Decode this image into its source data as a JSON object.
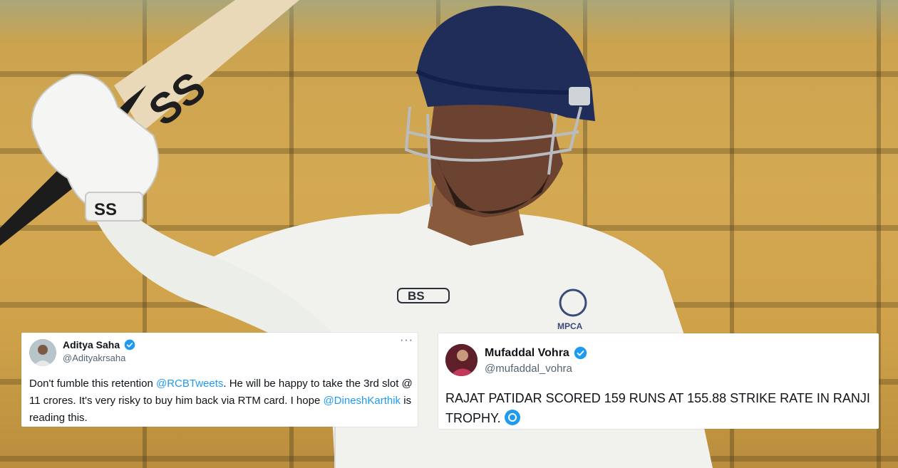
{
  "tweets": [
    {
      "author_name": "Aditya Saha",
      "author_handle": "@Adityakrsaha",
      "more_icon": "more-horizontal-icon",
      "segments": [
        {
          "text": "Don't fumble this retention ",
          "type": "text"
        },
        {
          "text": "@RCBTweets",
          "type": "mention"
        },
        {
          "text": ". He will be happy to take the 3rd slot @ 11 crores. It's very risky to buy him back via RTM card. I hope ",
          "type": "text"
        },
        {
          "text": "@DineshKarthik",
          "type": "mention"
        },
        {
          "text": " is reading this.",
          "type": "text"
        }
      ]
    },
    {
      "author_name": "Mufaddal Vohra",
      "author_handle": "@mufaddal_vohra",
      "segments": [
        {
          "text": "RAJAT PATIDAR SCORED 159 RUNS AT 155.88 STRIKE RATE IN RANJI TROPHY. ",
          "type": "text"
        }
      ],
      "emoji_icon": "blue-emoji-icon"
    }
  ],
  "photo": {
    "bat_brand": "SS",
    "shirt_logo": "BS",
    "badge_text": "MPCA"
  },
  "colors": {
    "mention": "#1d9bf0",
    "verified": "#1d9bf0",
    "handle": "#536471",
    "background_stands": "#d4a953"
  }
}
